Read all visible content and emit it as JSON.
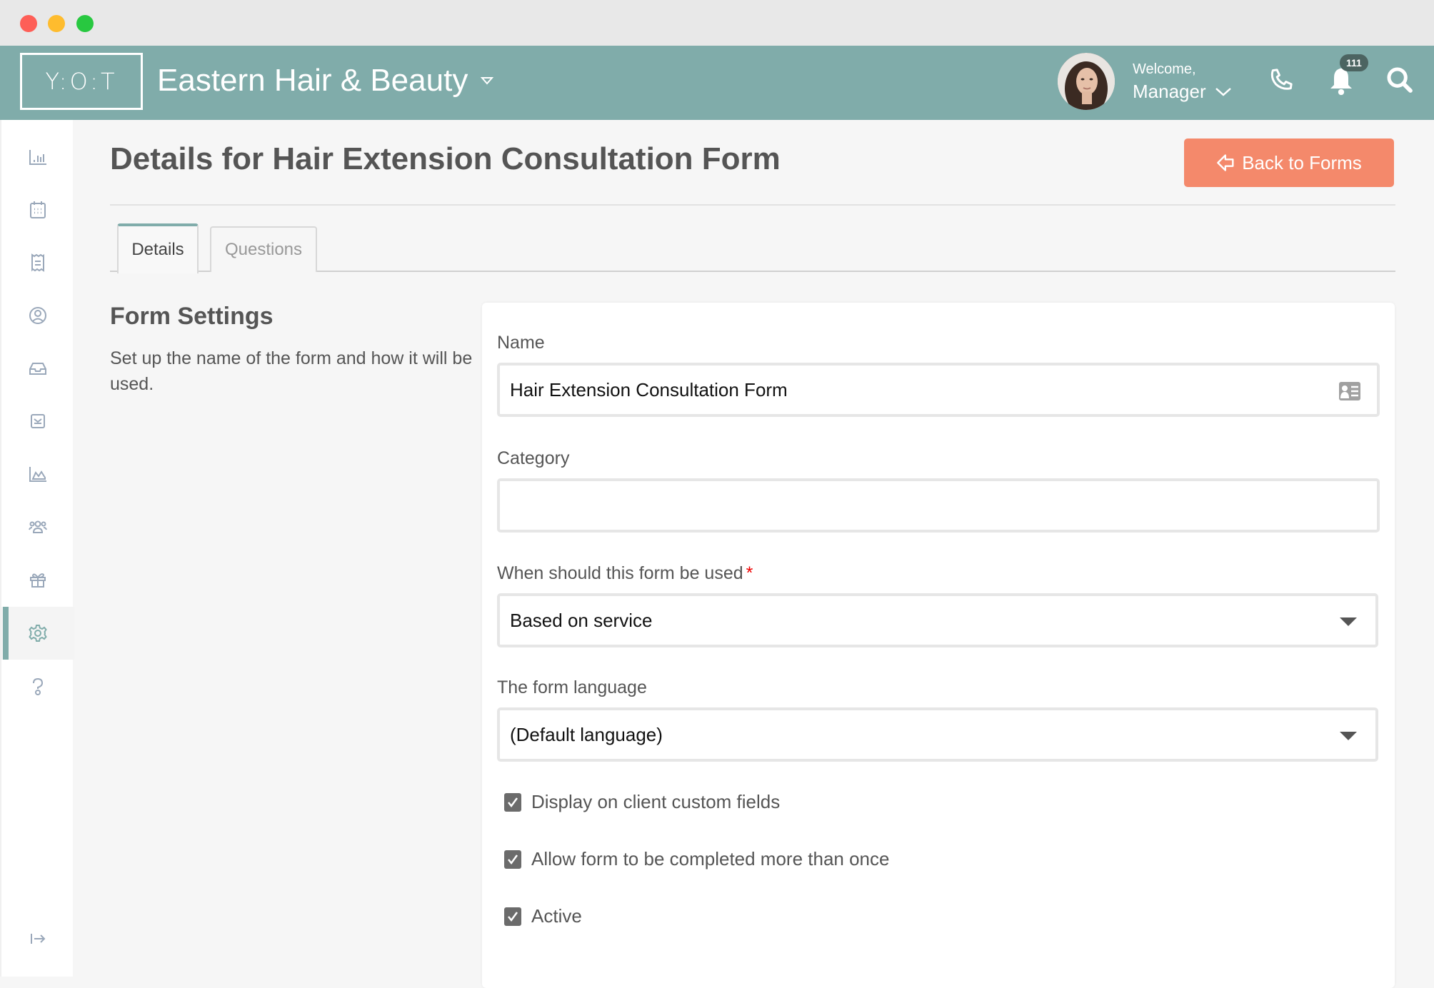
{
  "window": {
    "controls": [
      "close",
      "minimize",
      "maximize"
    ]
  },
  "header": {
    "logo": "Y:O:T",
    "business_name": "Eastern Hair & Beauty",
    "welcome": "Welcome,",
    "user_name": "Manager",
    "notification_count": "111",
    "icons": [
      "phone-icon",
      "bell-icon",
      "search-icon"
    ]
  },
  "sidebar": {
    "items": [
      {
        "icon": "bar-chart-icon",
        "active": false
      },
      {
        "icon": "calendar-icon",
        "active": false
      },
      {
        "icon": "receipt-icon",
        "active": false
      },
      {
        "icon": "user-circle-icon",
        "active": false
      },
      {
        "icon": "inbox-icon",
        "active": false
      },
      {
        "icon": "mail-icon",
        "active": false
      },
      {
        "icon": "area-chart-icon",
        "active": false
      },
      {
        "icon": "users-icon",
        "active": false
      },
      {
        "icon": "gift-icon",
        "active": false
      },
      {
        "icon": "gear-icon",
        "active": true
      },
      {
        "icon": "help-icon",
        "active": false
      }
    ],
    "logout_icon": "logout-icon"
  },
  "page": {
    "title": "Details for Hair Extension Consultation Form",
    "back_button": "Back to Forms",
    "tabs": [
      {
        "label": "Details",
        "active": true
      },
      {
        "label": "Questions",
        "active": false
      }
    ]
  },
  "section": {
    "title": "Form Settings",
    "description": "Set up the name of the form and how it will be used."
  },
  "form": {
    "name_label": "Name",
    "name_value": "Hair Extension Consultation Form",
    "category_label": "Category",
    "category_value": "",
    "usage_label": "When should this form be used",
    "usage_required": "*",
    "usage_value": "Based on service",
    "language_label": "The form language",
    "language_value": "(Default language)",
    "checkboxes": [
      {
        "label": "Display on client custom fields",
        "checked": true
      },
      {
        "label": "Allow form to be completed more than once",
        "checked": true
      },
      {
        "label": "Active",
        "checked": true
      }
    ]
  },
  "colors": {
    "header": "#80acaa",
    "accent_button": "#f4896b",
    "active_sidebar": "#80acaa"
  }
}
